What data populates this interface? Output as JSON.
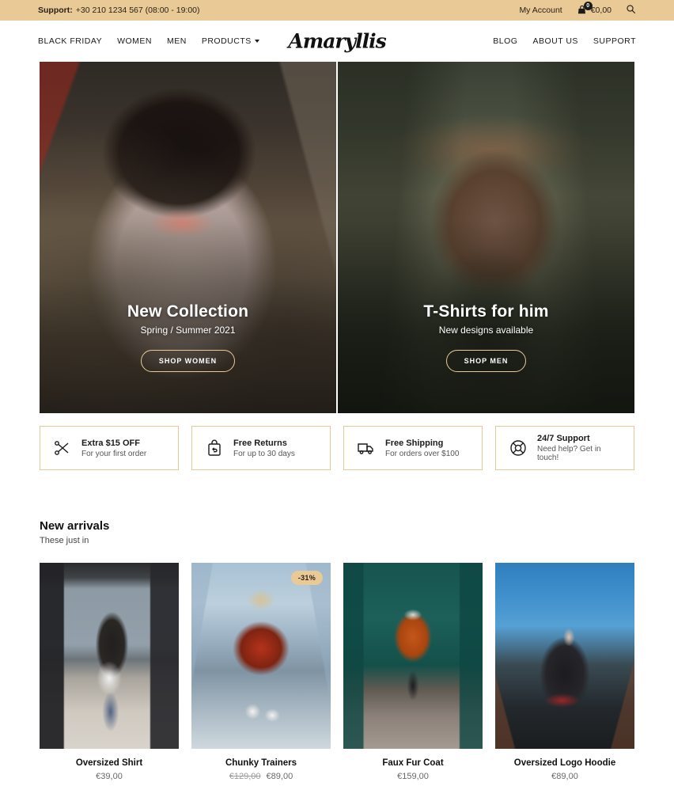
{
  "topbar": {
    "support_label": "Support:",
    "support_value": "+30 210 1234 567 (08:00 - 19:00)",
    "account_link": "My Account",
    "cart_count": "0",
    "cart_amount": "€0,00",
    "search_icon": "search-icon",
    "cart_icon": "shopping-bag-icon",
    "background_color": "#e9c996"
  },
  "nav": {
    "logo": "Amaryllis",
    "left_links": [
      {
        "label": "Black Friday",
        "has_caret": false
      },
      {
        "label": "Women",
        "has_caret": false
      },
      {
        "label": "Men",
        "has_caret": false
      },
      {
        "label": "Products",
        "has_caret": true
      }
    ],
    "right_links": [
      {
        "label": "Blog"
      },
      {
        "label": "About Us"
      },
      {
        "label": "Support"
      }
    ]
  },
  "hero": {
    "panels": [
      {
        "title": "New Collection",
        "subtitle": "Spring / Summer 2021",
        "button": "SHOP WOMEN"
      },
      {
        "title": "T-Shirts for him",
        "subtitle": "New designs available",
        "button": "SHOP MEN"
      }
    ],
    "button_border_color": "#e9c996"
  },
  "features": [
    {
      "icon": "scissors-icon",
      "title": "Extra $15 OFF",
      "desc": "For your first order"
    },
    {
      "icon": "return-bag-icon",
      "title": "Free Returns",
      "desc": "For up to 30 days"
    },
    {
      "icon": "delivery-truck-icon",
      "title": "Free Shipping",
      "desc": "For orders over $100"
    },
    {
      "icon": "lifebuoy-icon",
      "title": "24/7 Support",
      "desc": "Need help? Get in touch!"
    }
  ],
  "new_arrivals": {
    "title": "New arrivals",
    "subtitle": "These just in",
    "products": [
      {
        "name": "Oversized Shirt",
        "price": "€39,00",
        "old_price": "",
        "badge": ""
      },
      {
        "name": "Chunky Trainers",
        "price": "€89,00",
        "old_price": "€129,00",
        "badge": "-31%"
      },
      {
        "name": "Faux Fur Coat",
        "price": "€159,00",
        "old_price": "",
        "badge": ""
      },
      {
        "name": "Oversized Logo Hoodie",
        "price": "€89,00",
        "old_price": "",
        "badge": ""
      }
    ]
  }
}
